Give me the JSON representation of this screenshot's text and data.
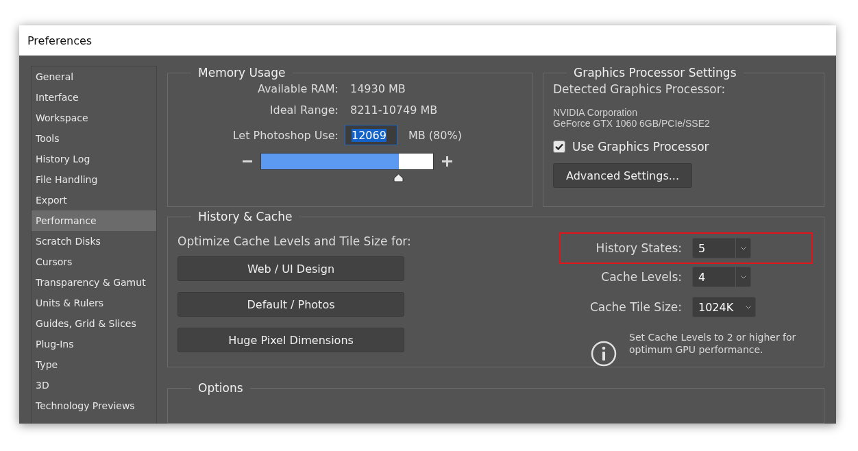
{
  "window": {
    "title": "Preferences"
  },
  "sidebar": {
    "items": [
      {
        "label": "General",
        "selected": false
      },
      {
        "label": "Interface",
        "selected": false
      },
      {
        "label": "Workspace",
        "selected": false
      },
      {
        "label": "Tools",
        "selected": false
      },
      {
        "label": "History Log",
        "selected": false
      },
      {
        "label": "File Handling",
        "selected": false
      },
      {
        "label": "Export",
        "selected": false
      },
      {
        "label": "Performance",
        "selected": true
      },
      {
        "label": "Scratch Disks",
        "selected": false
      },
      {
        "label": "Cursors",
        "selected": false
      },
      {
        "label": "Transparency & Gamut",
        "selected": false
      },
      {
        "label": "Units & Rulers",
        "selected": false
      },
      {
        "label": "Guides, Grid & Slices",
        "selected": false
      },
      {
        "label": "Plug-Ins",
        "selected": false
      },
      {
        "label": "Type",
        "selected": false
      },
      {
        "label": "3D",
        "selected": false
      },
      {
        "label": "Technology Previews",
        "selected": false
      }
    ]
  },
  "memory_usage": {
    "title": "Memory Usage",
    "rows": [
      {
        "label": "Available RAM:",
        "value": "14930 MB"
      },
      {
        "label": "Ideal Range:",
        "value": "8211-10749 MB"
      }
    ],
    "use": {
      "label": "Let Photoshop Use:",
      "value": "12069",
      "unit": "MB (80%)"
    },
    "slider": {
      "level": 0.8
    }
  },
  "gpu": {
    "title": "Graphics Processor Settings",
    "detected_label": "Detected Graphics Processor:",
    "vendor": "NVIDIA Corporation",
    "model": "GeForce GTX 1060 6GB/PCIe/SSE2",
    "use_gpu": {
      "label": "Use Graphics Processor",
      "checked": true
    },
    "advanced_button": "Advanced Settings..."
  },
  "history_cache": {
    "title": "History & Cache",
    "optimize_label": "Optimize Cache Levels and Tile Size for:",
    "presets": [
      "Web / UI Design",
      "Default / Photos",
      "Huge Pixel Dimensions"
    ],
    "fields": [
      {
        "label": "History States:",
        "value": "5",
        "kind": "split",
        "highlighted": true
      },
      {
        "label": "Cache Levels:",
        "value": "4",
        "kind": "split",
        "highlighted": false
      },
      {
        "label": "Cache Tile Size:",
        "value": "1024K",
        "kind": "compact",
        "highlighted": false
      }
    ],
    "note": "Set Cache Levels to 2 or higher for optimum GPU performance."
  },
  "options": {
    "title": "Options"
  }
}
